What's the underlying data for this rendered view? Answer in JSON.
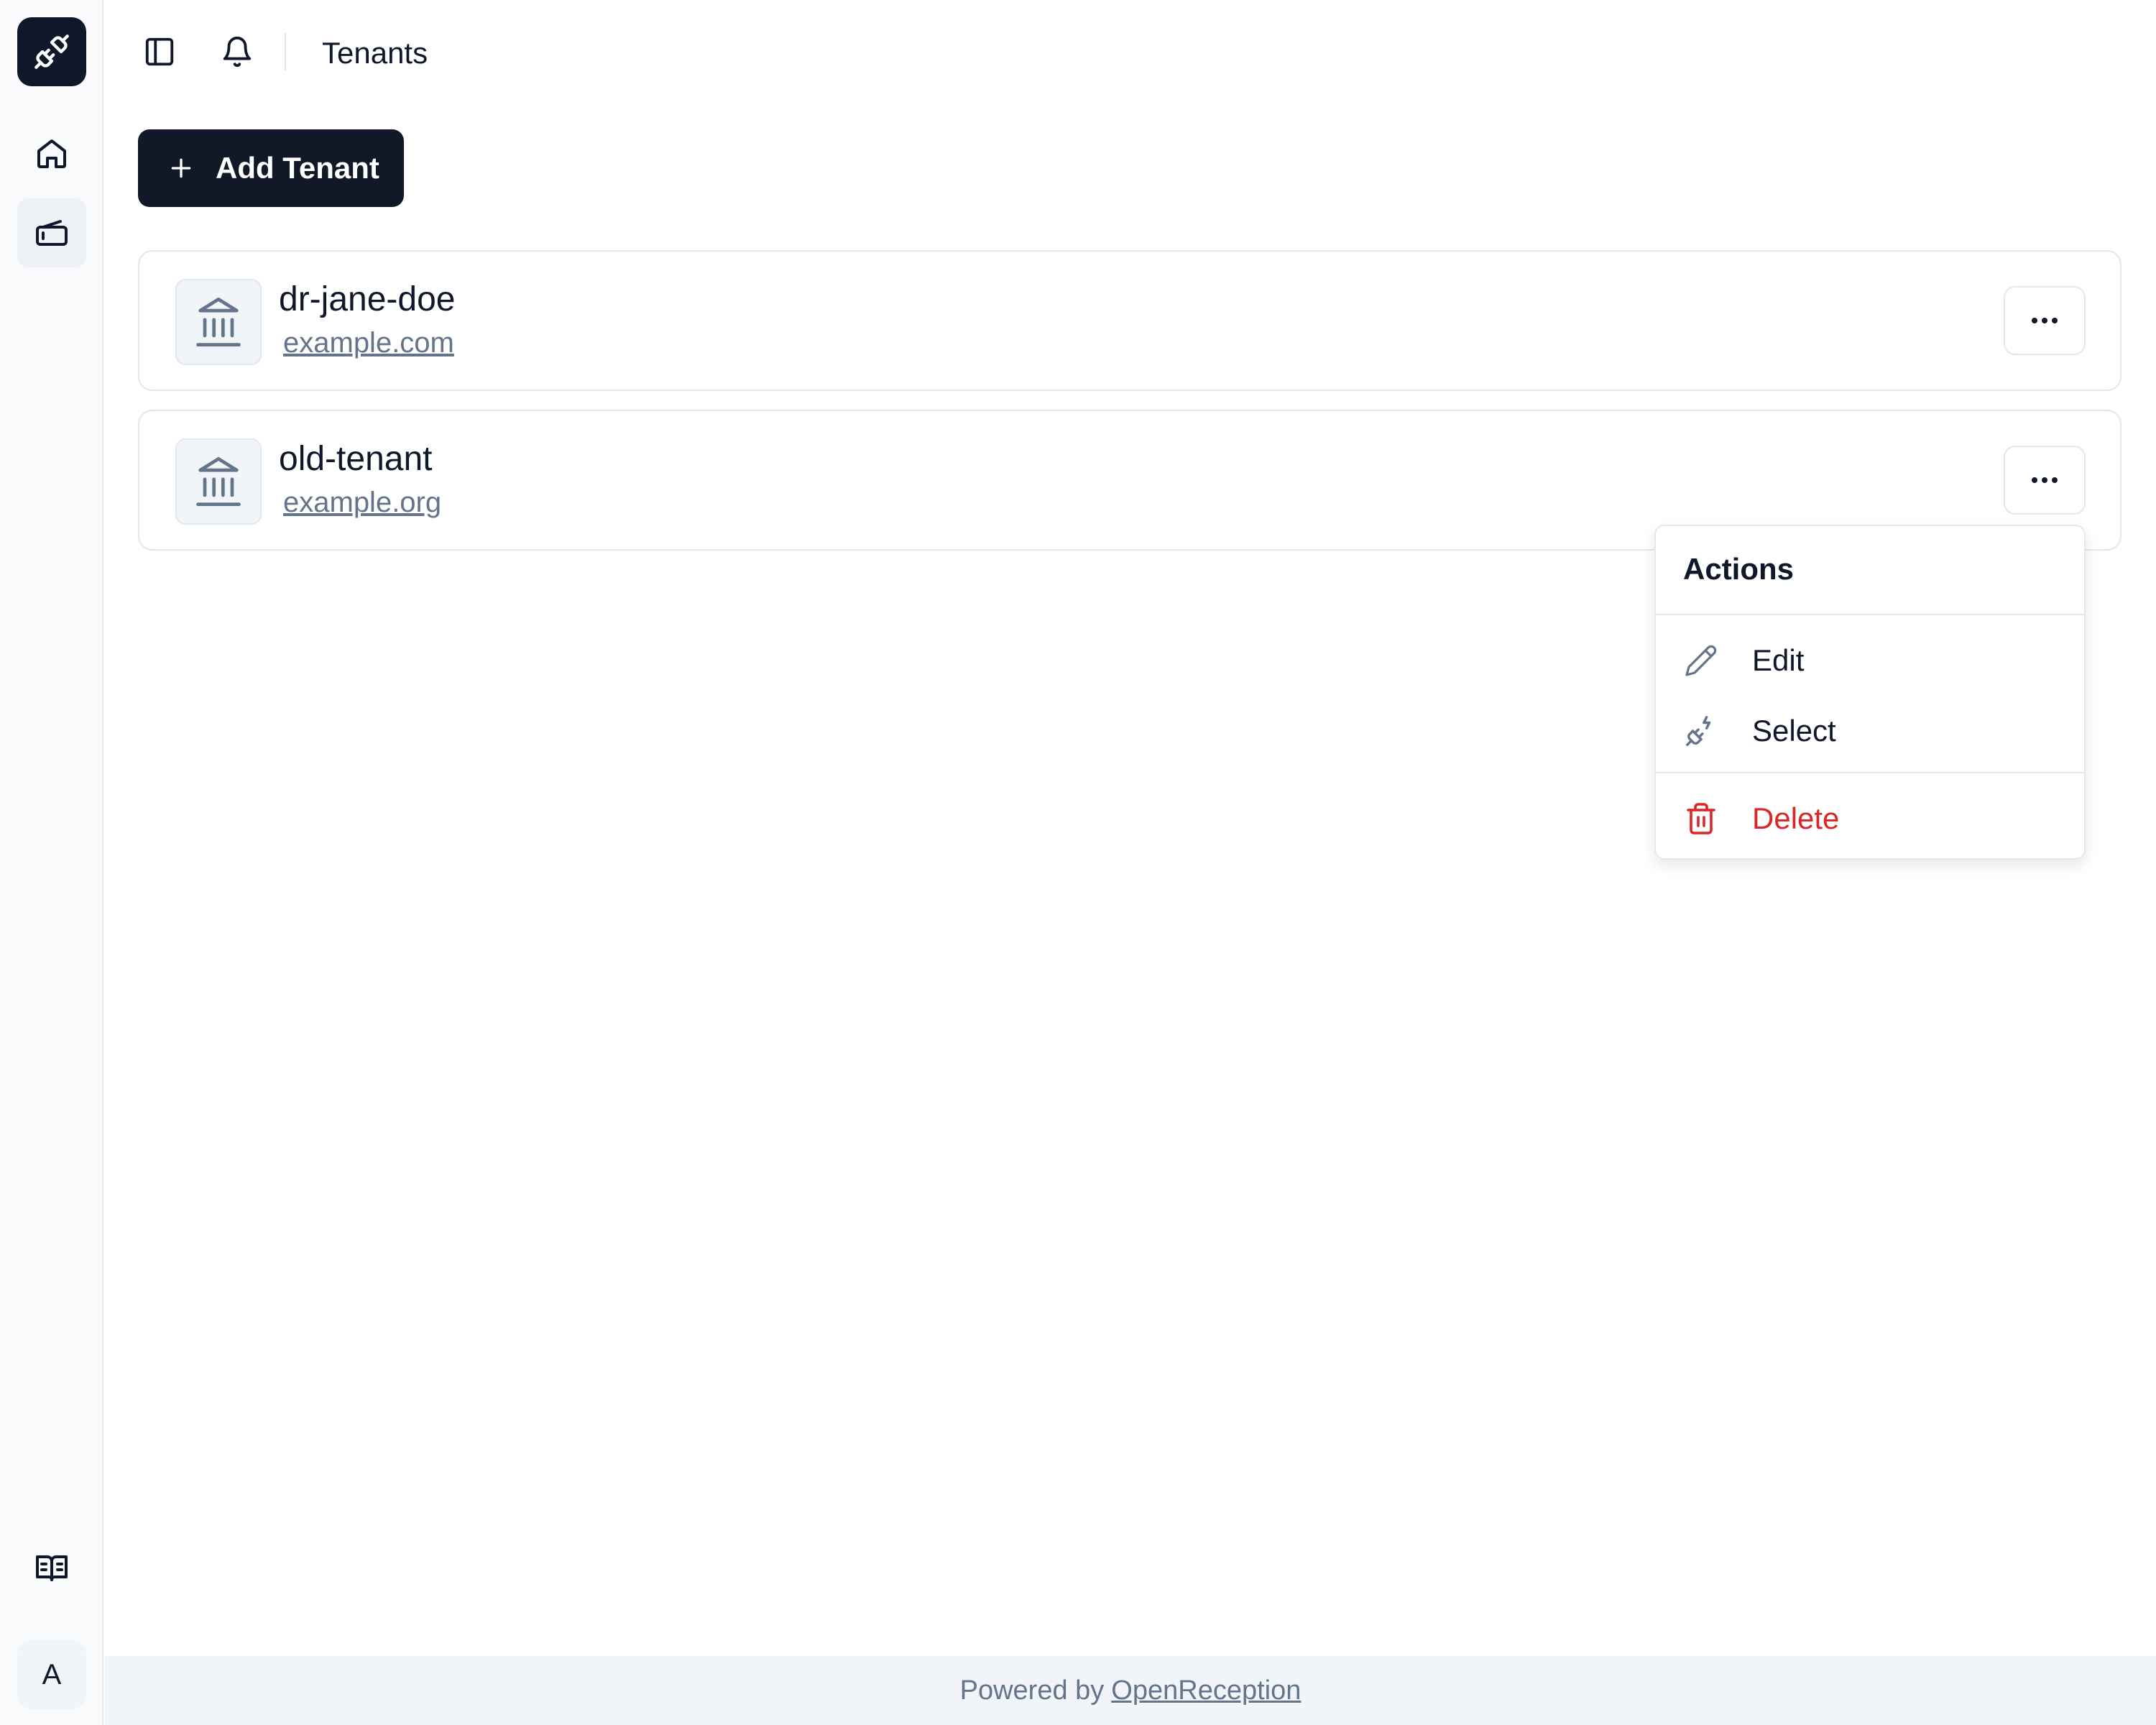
{
  "header": {
    "title": "Tenants"
  },
  "toolbar": {
    "add_label": "Add Tenant"
  },
  "tenants": [
    {
      "name": "dr-jane-doe",
      "domain": "example.com"
    },
    {
      "name": "old-tenant",
      "domain": "example.org"
    }
  ],
  "menu": {
    "title": "Actions",
    "items": [
      {
        "label": "Edit",
        "icon": "pencil-icon"
      },
      {
        "label": "Select",
        "icon": "plug-icon"
      },
      {
        "label": "Delete",
        "icon": "trash-icon"
      }
    ]
  },
  "sidebar": {
    "avatar_initial": "A"
  },
  "footer": {
    "prefix": "Powered by",
    "link": "OpenReception"
  },
  "colors": {
    "primary": "#111827",
    "danger": "#dc2626",
    "muted": "#64748b"
  }
}
